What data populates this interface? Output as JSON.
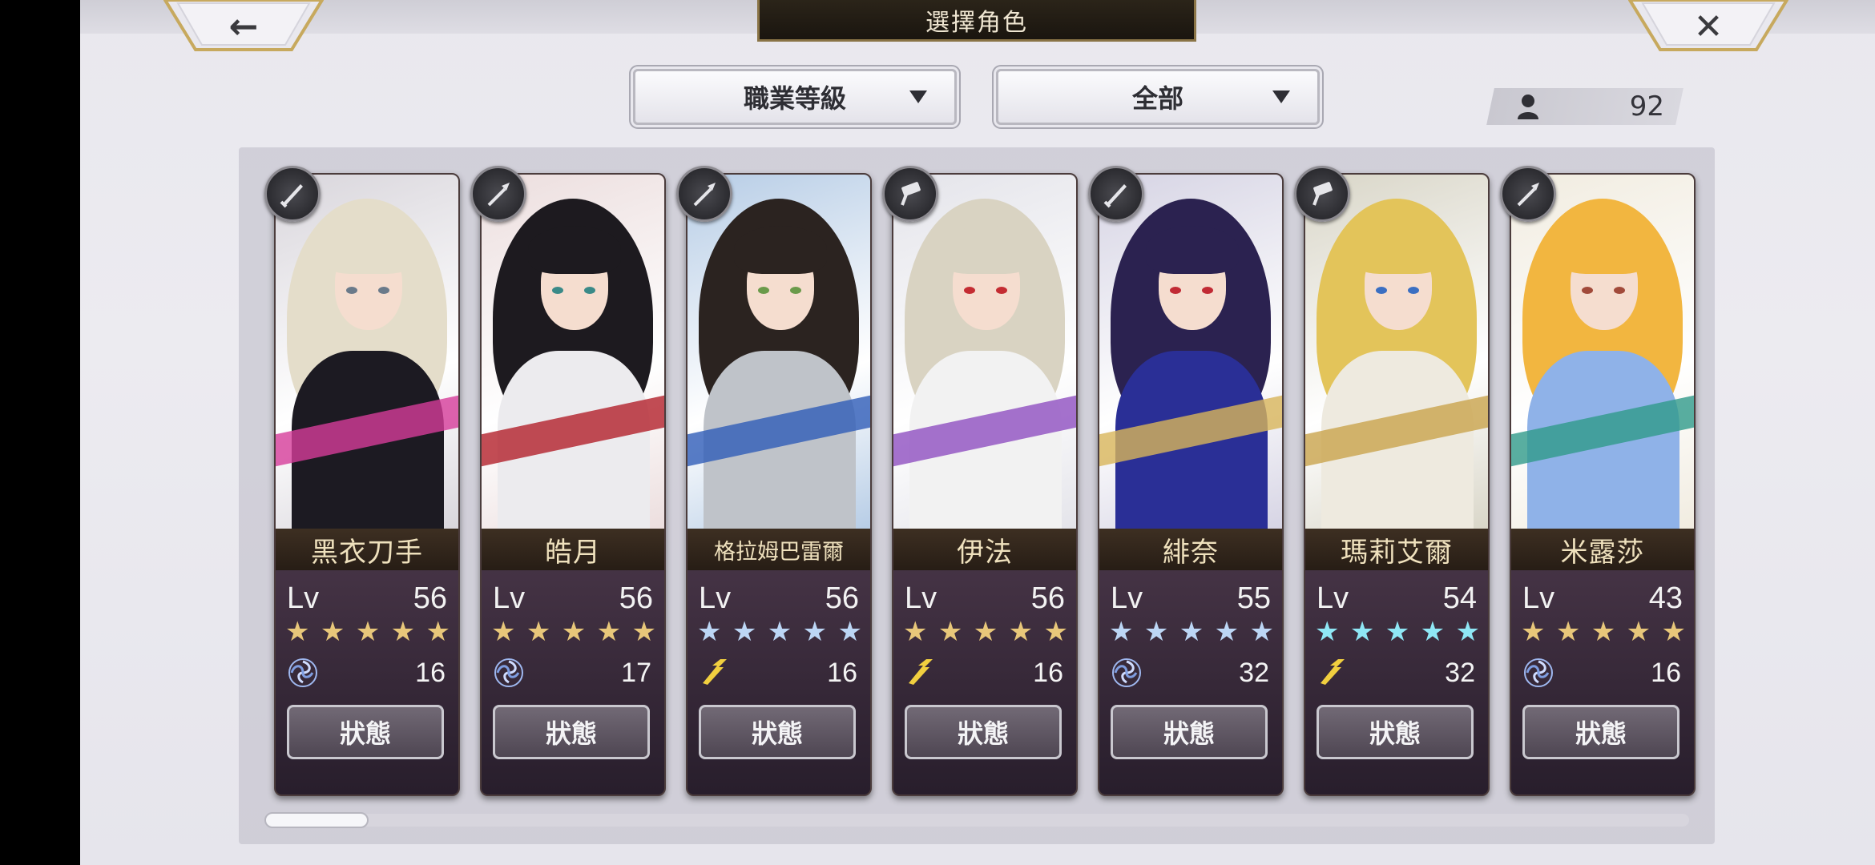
{
  "header": {
    "title": "選擇角色",
    "back_icon": "←",
    "close_icon": "✕"
  },
  "filters": {
    "sort_label": "職業等級",
    "filter_label": "全部"
  },
  "roster": {
    "count": "92"
  },
  "characters": [
    {
      "name": "黑衣刀手",
      "lv_label": "Lv",
      "level": "56",
      "stars": 5,
      "star_color": "#e8c77a",
      "element": "wind",
      "value": "16",
      "status_label": "狀態",
      "class_icon": "blade-icon",
      "hair": "#e4ddca",
      "outfit": "#1c1a22",
      "accent": "#d63c9a",
      "eyes": "#6a7a8a",
      "bg": "#d9d6dc"
    },
    {
      "name": "皓月",
      "lv_label": "Lv",
      "level": "56",
      "stars": 5,
      "star_color": "#e8c77a",
      "element": "wind",
      "value": "17",
      "status_label": "狀態",
      "class_icon": "spear-icon",
      "hair": "#1d1a1f",
      "outfit": "#ecebee",
      "accent": "#b3212a",
      "eyes": "#3a8a88",
      "bg": "#ecdede"
    },
    {
      "name": "格拉姆巴雷爾",
      "lv_label": "Lv",
      "level": "56",
      "stars": 5,
      "star_color": "#bcd6f5",
      "element": "lightning",
      "value": "16",
      "status_label": "狀態",
      "class_icon": "spear-icon",
      "hair": "#2b2320",
      "outfit": "#bfc3c9",
      "accent": "#2f5db8",
      "eyes": "#6a9a4a",
      "bg": "#b7cde6"
    },
    {
      "name": "伊法",
      "lv_label": "Lv",
      "level": "56",
      "stars": 5,
      "star_color": "#e8c77a",
      "element": "lightning",
      "value": "16",
      "status_label": "狀態",
      "class_icon": "hammer-icon",
      "hair": "#d9d3c2",
      "outfit": "#f2f2f2",
      "accent": "#8e4fc1",
      "eyes": "#c42c32",
      "bg": "#e4e4ea"
    },
    {
      "name": "緋奈",
      "lv_label": "Lv",
      "level": "55",
      "stars": 5,
      "star_color": "#bcd6f5",
      "element": "wind",
      "value": "32",
      "status_label": "狀態",
      "class_icon": "blade-icon",
      "hair": "#2b2250",
      "outfit": "#2a2f96",
      "accent": "#d8b55a",
      "eyes": "#c12a34",
      "bg": "#d6d4e4"
    },
    {
      "name": "瑪莉艾爾",
      "lv_label": "Lv",
      "level": "54",
      "stars": 5,
      "star_color": "#8fe7f5",
      "element": "lightning",
      "value": "32",
      "status_label": "狀態",
      "class_icon": "hammer-icon",
      "hair": "#e3c45a",
      "outfit": "#eeeadf",
      "accent": "#c9a44c",
      "eyes": "#3b6fc2",
      "bg": "#d9d6c8"
    },
    {
      "name": "米露莎",
      "lv_label": "Lv",
      "level": "43",
      "stars": 5,
      "star_color": "#e8c77a",
      "element": "wind",
      "value": "16",
      "status_label": "狀態",
      "class_icon": "spear-icon",
      "hair": "#f2b640",
      "outfit": "#8fb2e8",
      "accent": "#2f9a8a",
      "eyes": "#a14a3a",
      "bg": "#f1ece0"
    }
  ]
}
